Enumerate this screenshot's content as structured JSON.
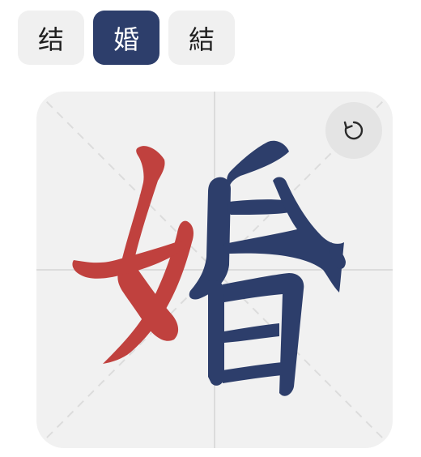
{
  "variants": [
    {
      "label": "结",
      "active": false
    },
    {
      "label": "婚",
      "active": true
    },
    {
      "label": "結",
      "active": false
    }
  ],
  "colors": {
    "accent": "#2d3e6b",
    "radical_stroke": "#c0413e",
    "remaining_strokes": "#2d3e6b",
    "grid_line": "#dcdcdc"
  },
  "replay": {
    "icon": "replay-icon"
  }
}
